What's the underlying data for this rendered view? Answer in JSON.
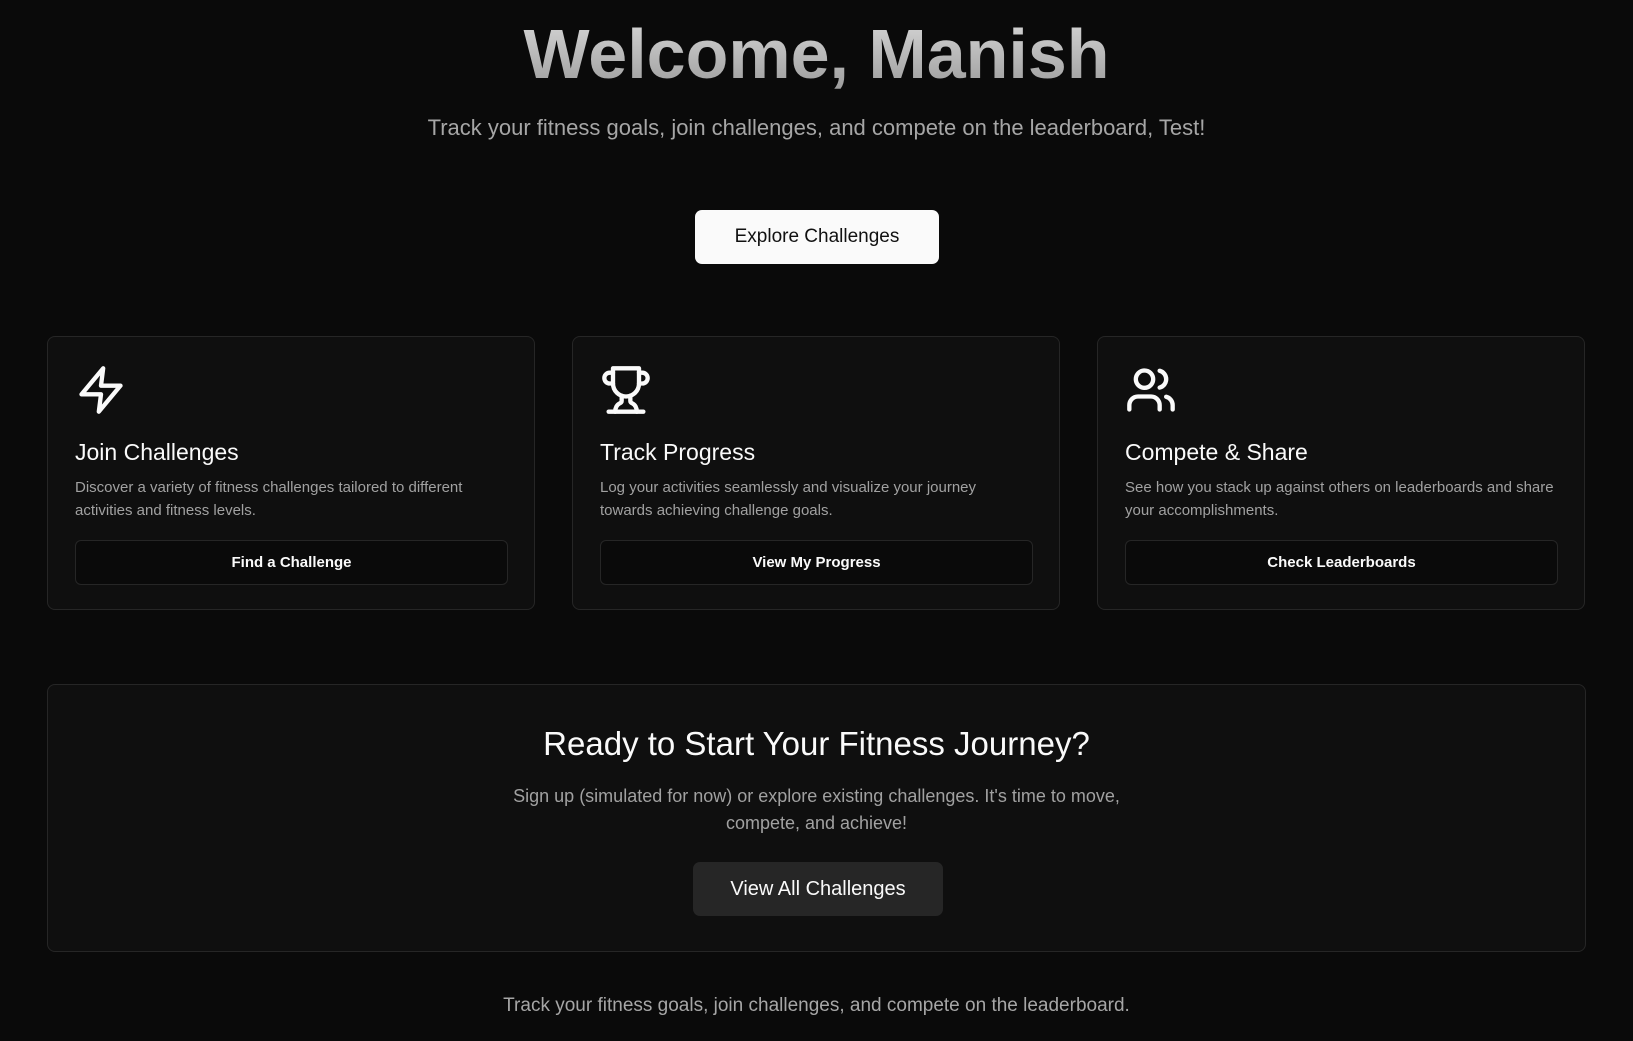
{
  "hero": {
    "title": "Welcome, Manish",
    "subtitle": "Track your fitness goals, join challenges, and compete on the leaderboard, Test!",
    "button_label": "Explore Challenges"
  },
  "cards": [
    {
      "icon": "lightning-icon",
      "title": "Join Challenges",
      "description": "Discover a variety of fitness challenges tailored to different activities and fitness levels.",
      "button_label": "Find a Challenge"
    },
    {
      "icon": "trophy-icon",
      "title": "Track Progress",
      "description": "Log your activities seamlessly and visualize your journey towards achieving challenge goals.",
      "button_label": "View My Progress"
    },
    {
      "icon": "users-icon",
      "title": "Compete & Share",
      "description": "See how you stack up against others on leaderboards and share your accomplishments.",
      "button_label": "Check Leaderboards"
    }
  ],
  "cta": {
    "title": "Ready to Start Your Fitness Journey?",
    "description": "Sign up (simulated for now) or explore existing challenges. It's time to move, compete, and achieve!",
    "button_label": "View All Challenges"
  },
  "footer": {
    "text": "Track your fitness goals, join challenges, and compete on the leaderboard."
  },
  "colors": {
    "background": "#0a0a0a",
    "card_background": "#0f0f0f",
    "border": "#262626",
    "primary_button": "#fafafa",
    "secondary_button": "#262626",
    "muted_text": "#a1a1a1"
  }
}
